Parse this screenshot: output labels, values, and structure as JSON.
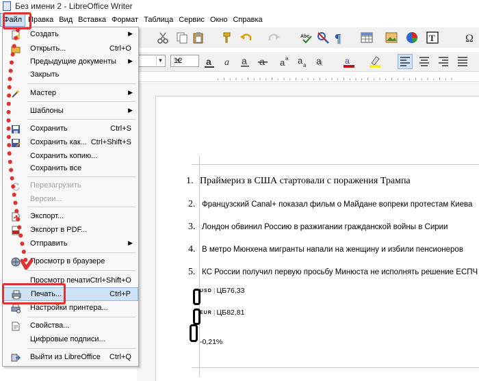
{
  "window": {
    "title": "Без имени 2 - LibreOffice Writer"
  },
  "menubar": {
    "items": [
      {
        "label": "Файл"
      },
      {
        "label": "Правка"
      },
      {
        "label": "Вид"
      },
      {
        "label": "Вставка"
      },
      {
        "label": "Формат"
      },
      {
        "label": "Таблица"
      },
      {
        "label": "Сервис"
      },
      {
        "label": "Окно"
      },
      {
        "label": "Справка"
      }
    ]
  },
  "toolbar": {
    "font_size": "12"
  },
  "file_menu": {
    "items": [
      {
        "label": "Создать",
        "shortcut": "",
        "submenu": true,
        "icon": "new-document-icon"
      },
      {
        "label": "Открыть...",
        "shortcut": "Ctrl+O",
        "icon": "open-folder-icon"
      },
      {
        "label": "Предыдущие документы",
        "shortcut": "",
        "submenu": true,
        "icon": ""
      },
      {
        "label": "Закрыть",
        "shortcut": "",
        "icon": ""
      },
      {
        "label": "Мастер",
        "shortcut": "",
        "submenu": true,
        "icon": "wizard-icon"
      },
      {
        "label": "Шаблоны",
        "shortcut": "",
        "submenu": true,
        "icon": ""
      },
      {
        "label": "Сохранить",
        "shortcut": "Ctrl+S",
        "icon": "save-icon"
      },
      {
        "label": "Сохранить как...",
        "shortcut": "Ctrl+Shift+S",
        "icon": "save-as-icon"
      },
      {
        "label": "Сохранить копию...",
        "shortcut": "",
        "icon": ""
      },
      {
        "label": "Сохранить все",
        "shortcut": "",
        "icon": ""
      },
      {
        "label": "Перезагрузить",
        "shortcut": "",
        "disabled": true,
        "icon": "reload-icon"
      },
      {
        "label": "Версии...",
        "shortcut": "",
        "disabled": true,
        "icon": ""
      },
      {
        "label": "Экспорт...",
        "shortcut": "",
        "icon": "export-icon"
      },
      {
        "label": "Экспорт в PDF...",
        "shortcut": "",
        "icon": "pdf-icon"
      },
      {
        "label": "Отправить",
        "shortcut": "",
        "submenu": true,
        "icon": ""
      },
      {
        "label": "Просмотр в браузере",
        "shortcut": "",
        "icon": "browser-icon"
      },
      {
        "label": "Просмотр печати",
        "shortcut": "Ctrl+Shift+O",
        "icon": ""
      },
      {
        "label": "Печать...",
        "shortcut": "Ctrl+P",
        "icon": "printer-icon",
        "highlighted": true
      },
      {
        "label": "Настройки принтера...",
        "shortcut": "",
        "icon": "printer-settings-icon"
      },
      {
        "label": "Свойства...",
        "shortcut": "",
        "icon": "properties-icon"
      },
      {
        "label": "Цифровые подписи...",
        "shortcut": "",
        "icon": ""
      },
      {
        "label": "Выйти из LibreOffice",
        "shortcut": "Ctrl+Q",
        "icon": "exit-icon"
      }
    ]
  },
  "document": {
    "list": [
      {
        "num": "1.",
        "text": "Праймериз в США стартовали с поражения Трампа"
      },
      {
        "num": "2.",
        "text": "Французский Canal+ показал фильм о Майдане вопреки протестам Киева"
      },
      {
        "num": "3.",
        "text": "Лондон обвинил Россию в разжигании гражданской войны в Сирии"
      },
      {
        "num": "4.",
        "text": "В метро Мюнхена мигранты напали на женщину и избили пенсионеров"
      },
      {
        "num": "5.",
        "text": "КС России получил первую просьбу Минюста не исполнять решение ЕСПЧ"
      }
    ],
    "tickers": [
      {
        "code": "USD",
        "source": "ЦБ",
        "value": "76,33"
      },
      {
        "code": "EUR",
        "source": "ЦБ",
        "value": "82,81"
      }
    ],
    "change": "-0,21%"
  },
  "colors": {
    "highlight": "#cfe3f7",
    "annotation_red": "#e03030"
  }
}
